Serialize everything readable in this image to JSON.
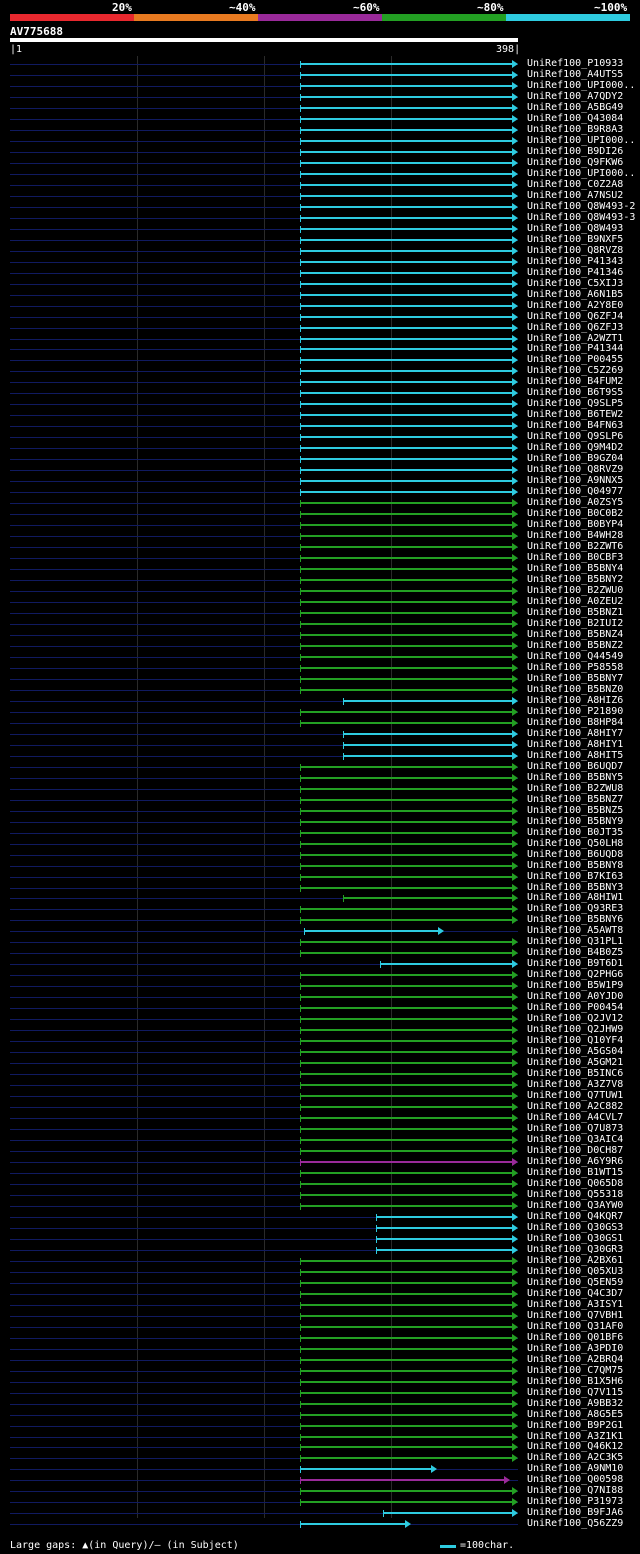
{
  "legend": {
    "labels": [
      "20%",
      "~40%",
      "~60%",
      "~80%",
      "~100%"
    ],
    "colors": [
      "#e8282e",
      "#e87a20",
      "#9a2a9a",
      "#23a023",
      "#2ecbe0"
    ]
  },
  "query": {
    "id": "AV775688",
    "start": "1",
    "end": "398"
  },
  "rows": [
    {
      "label": "UniRef100_P10933",
      "color": "cyan",
      "s": 0.57,
      "e": 1.0
    },
    {
      "label": "UniRef100_A4UTS5",
      "color": "cyan",
      "s": 0.57,
      "e": 1.0
    },
    {
      "label": "UniRef100_UPI000..",
      "color": "cyan",
      "s": 0.57,
      "e": 1.0
    },
    {
      "label": "UniRef100_A7QDY2",
      "color": "cyan",
      "s": 0.57,
      "e": 1.0
    },
    {
      "label": "UniRef100_A5BG49",
      "color": "cyan",
      "s": 0.57,
      "e": 1.0
    },
    {
      "label": "UniRef100_Q43084",
      "color": "cyan",
      "s": 0.57,
      "e": 1.0
    },
    {
      "label": "UniRef100_B9R8A3",
      "color": "cyan",
      "s": 0.57,
      "e": 1.0
    },
    {
      "label": "UniRef100_UPI000..",
      "color": "cyan",
      "s": 0.57,
      "e": 1.0
    },
    {
      "label": "UniRef100_B9DI26",
      "color": "cyan",
      "s": 0.57,
      "e": 1.0
    },
    {
      "label": "UniRef100_Q9FKW6",
      "color": "cyan",
      "s": 0.57,
      "e": 1.0
    },
    {
      "label": "UniRef100_UPI000..",
      "color": "cyan",
      "s": 0.57,
      "e": 1.0
    },
    {
      "label": "UniRef100_C0Z2A8",
      "color": "cyan",
      "s": 0.57,
      "e": 1.0
    },
    {
      "label": "UniRef100_A7NSU2",
      "color": "cyan",
      "s": 0.57,
      "e": 1.0
    },
    {
      "label": "UniRef100_Q8W493-2",
      "color": "cyan",
      "s": 0.57,
      "e": 1.0
    },
    {
      "label": "UniRef100_Q8W493-3",
      "color": "cyan",
      "s": 0.57,
      "e": 1.0
    },
    {
      "label": "UniRef100_Q8W493",
      "color": "cyan",
      "s": 0.57,
      "e": 1.0
    },
    {
      "label": "UniRef100_B9NXF5",
      "color": "cyan",
      "s": 0.57,
      "e": 1.0
    },
    {
      "label": "UniRef100_Q8RVZ8",
      "color": "cyan",
      "s": 0.57,
      "e": 1.0
    },
    {
      "label": "UniRef100_P41343",
      "color": "cyan",
      "s": 0.57,
      "e": 1.0
    },
    {
      "label": "UniRef100_P41346",
      "color": "cyan",
      "s": 0.57,
      "e": 1.0
    },
    {
      "label": "UniRef100_C5XIJ3",
      "color": "cyan",
      "s": 0.57,
      "e": 1.0
    },
    {
      "label": "UniRef100_A6N1B5",
      "color": "cyan",
      "s": 0.57,
      "e": 1.0
    },
    {
      "label": "UniRef100_A2Y8E0",
      "color": "cyan",
      "s": 0.57,
      "e": 1.0
    },
    {
      "label": "UniRef100_Q6ZFJ4",
      "color": "cyan",
      "s": 0.57,
      "e": 1.0
    },
    {
      "label": "UniRef100_Q6ZFJ3",
      "color": "cyan",
      "s": 0.57,
      "e": 1.0
    },
    {
      "label": "UniRef100_A2WZT1",
      "color": "cyan",
      "s": 0.57,
      "e": 1.0
    },
    {
      "label": "UniRef100_P41344",
      "color": "cyan",
      "s": 0.57,
      "e": 1.0
    },
    {
      "label": "UniRef100_P00455",
      "color": "cyan",
      "s": 0.57,
      "e": 1.0
    },
    {
      "label": "UniRef100_C5Z269",
      "color": "cyan",
      "s": 0.57,
      "e": 1.0
    },
    {
      "label": "UniRef100_B4FUM2",
      "color": "cyan",
      "s": 0.57,
      "e": 1.0
    },
    {
      "label": "UniRef100_B6T9S5",
      "color": "cyan",
      "s": 0.57,
      "e": 1.0
    },
    {
      "label": "UniRef100_Q9SLP5",
      "color": "cyan",
      "s": 0.57,
      "e": 1.0
    },
    {
      "label": "UniRef100_B6TEW2",
      "color": "cyan",
      "s": 0.57,
      "e": 1.0
    },
    {
      "label": "UniRef100_B4FN63",
      "color": "cyan",
      "s": 0.57,
      "e": 1.0
    },
    {
      "label": "UniRef100_Q9SLP6",
      "color": "cyan",
      "s": 0.57,
      "e": 1.0
    },
    {
      "label": "UniRef100_Q9M4D2",
      "color": "cyan",
      "s": 0.57,
      "e": 1.0
    },
    {
      "label": "UniRef100_B9GZ04",
      "color": "cyan",
      "s": 0.57,
      "e": 1.0
    },
    {
      "label": "UniRef100_Q8RVZ9",
      "color": "cyan",
      "s": 0.57,
      "e": 1.0
    },
    {
      "label": "UniRef100_A9NNX5",
      "color": "cyan",
      "s": 0.57,
      "e": 1.0
    },
    {
      "label": "UniRef100_Q04977",
      "color": "cyan",
      "s": 0.57,
      "e": 1.0
    },
    {
      "label": "UniRef100_A0ZSY5",
      "color": "green",
      "s": 0.57,
      "e": 1.0
    },
    {
      "label": "UniRef100_B0C0B2",
      "color": "green",
      "s": 0.57,
      "e": 1.0
    },
    {
      "label": "UniRef100_B0BYP4",
      "color": "green",
      "s": 0.57,
      "e": 1.0
    },
    {
      "label": "UniRef100_B4WH28",
      "color": "green",
      "s": 0.57,
      "e": 1.0
    },
    {
      "label": "UniRef100_B2ZWT6",
      "color": "green",
      "s": 0.57,
      "e": 1.0
    },
    {
      "label": "UniRef100_B0CBF3",
      "color": "green",
      "s": 0.57,
      "e": 1.0
    },
    {
      "label": "UniRef100_B5BNY4",
      "color": "green",
      "s": 0.57,
      "e": 1.0
    },
    {
      "label": "UniRef100_B5BNY2",
      "color": "green",
      "s": 0.57,
      "e": 1.0
    },
    {
      "label": "UniRef100_B2ZWU0",
      "color": "green",
      "s": 0.57,
      "e": 1.0
    },
    {
      "label": "UniRef100_A0ZEU2",
      "color": "green",
      "s": 0.57,
      "e": 1.0
    },
    {
      "label": "UniRef100_B5BNZ1",
      "color": "green",
      "s": 0.57,
      "e": 1.0
    },
    {
      "label": "UniRef100_B2IUI2",
      "color": "green",
      "s": 0.57,
      "e": 1.0
    },
    {
      "label": "UniRef100_B5BNZ4",
      "color": "green",
      "s": 0.57,
      "e": 1.0
    },
    {
      "label": "UniRef100_B5BNZ2",
      "color": "green",
      "s": 0.57,
      "e": 1.0
    },
    {
      "label": "UniRef100_Q44549",
      "color": "green",
      "s": 0.57,
      "e": 1.0
    },
    {
      "label": "UniRef100_P58558",
      "color": "green",
      "s": 0.57,
      "e": 1.0
    },
    {
      "label": "UniRef100_B5BNY7",
      "color": "green",
      "s": 0.57,
      "e": 1.0
    },
    {
      "label": "UniRef100_B5BNZ0",
      "color": "green",
      "s": 0.57,
      "e": 1.0
    },
    {
      "label": "UniRef100_A8HIZ6",
      "color": "cyan",
      "s": 0.655,
      "e": 1.0
    },
    {
      "label": "UniRef100_P21890",
      "color": "green",
      "s": 0.57,
      "e": 1.0
    },
    {
      "label": "UniRef100_B8HP84",
      "color": "green",
      "s": 0.57,
      "e": 1.0
    },
    {
      "label": "UniRef100_A8HIY7",
      "color": "cyan",
      "s": 0.655,
      "e": 1.0
    },
    {
      "label": "UniRef100_A8HIY1",
      "color": "cyan",
      "s": 0.655,
      "e": 1.0
    },
    {
      "label": "UniRef100_A8HIT5",
      "color": "cyan",
      "s": 0.655,
      "e": 1.0
    },
    {
      "label": "UniRef100_B6UQD7",
      "color": "green",
      "s": 0.57,
      "e": 1.0
    },
    {
      "label": "UniRef100_B5BNY5",
      "color": "green",
      "s": 0.57,
      "e": 1.0
    },
    {
      "label": "UniRef100_B2ZWU8",
      "color": "green",
      "s": 0.57,
      "e": 1.0
    },
    {
      "label": "UniRef100_B5BNZ7",
      "color": "green",
      "s": 0.57,
      "e": 1.0
    },
    {
      "label": "UniRef100_B5BNZ5",
      "color": "green",
      "s": 0.57,
      "e": 1.0
    },
    {
      "label": "UniRef100_B5BNY9",
      "color": "green",
      "s": 0.57,
      "e": 1.0
    },
    {
      "label": "UniRef100_B0JT35",
      "color": "green",
      "s": 0.57,
      "e": 1.0
    },
    {
      "label": "UniRef100_Q50LH8",
      "color": "green",
      "s": 0.57,
      "e": 1.0
    },
    {
      "label": "UniRef100_B6UQD8",
      "color": "green",
      "s": 0.57,
      "e": 1.0
    },
    {
      "label": "UniRef100_B5BNY8",
      "color": "green",
      "s": 0.57,
      "e": 1.0
    },
    {
      "label": "UniRef100_B7KI63",
      "color": "green",
      "s": 0.57,
      "e": 1.0
    },
    {
      "label": "UniRef100_B5BNY3",
      "color": "green",
      "s": 0.57,
      "e": 1.0
    },
    {
      "label": "UniRef100_A8HIW1",
      "color": "green",
      "s": 0.655,
      "e": 1.0
    },
    {
      "label": "UniRef100_Q93RE3",
      "color": "green",
      "s": 0.57,
      "e": 1.0
    },
    {
      "label": "UniRef100_B5BNY6",
      "color": "green",
      "s": 0.57,
      "e": 1.0
    },
    {
      "label": "UniRef100_A5AWT8",
      "color": "cyan",
      "s": 0.578,
      "e": 0.855
    },
    {
      "label": "UniRef100_Q31PL1",
      "color": "green",
      "s": 0.57,
      "e": 1.0
    },
    {
      "label": "UniRef100_B4B0Z5",
      "color": "green",
      "s": 0.57,
      "e": 1.0
    },
    {
      "label": "UniRef100_B9T6D1",
      "color": "cyan",
      "s": 0.728,
      "e": 1.0
    },
    {
      "label": "UniRef100_Q2PHG6",
      "color": "green",
      "s": 0.57,
      "e": 1.0
    },
    {
      "label": "UniRef100_B5W1P9",
      "color": "green",
      "s": 0.57,
      "e": 1.0
    },
    {
      "label": "UniRef100_A0YJD0",
      "color": "green",
      "s": 0.57,
      "e": 1.0
    },
    {
      "label": "UniRef100_P00454",
      "color": "green",
      "s": 0.57,
      "e": 1.0
    },
    {
      "label": "UniRef100_Q2JV12",
      "color": "green",
      "s": 0.57,
      "e": 1.0
    },
    {
      "label": "UniRef100_Q2JHW9",
      "color": "green",
      "s": 0.57,
      "e": 1.0
    },
    {
      "label": "UniRef100_Q10YF4",
      "color": "green",
      "s": 0.57,
      "e": 1.0
    },
    {
      "label": "UniRef100_A5GS04",
      "color": "green",
      "s": 0.57,
      "e": 1.0
    },
    {
      "label": "UniRef100_A5GM21",
      "color": "green",
      "s": 0.57,
      "e": 1.0
    },
    {
      "label": "UniRef100_B5INC6",
      "color": "green",
      "s": 0.57,
      "e": 1.0
    },
    {
      "label": "UniRef100_A3Z7V8",
      "color": "green",
      "s": 0.57,
      "e": 1.0
    },
    {
      "label": "UniRef100_Q7TUW1",
      "color": "green",
      "s": 0.57,
      "e": 1.0
    },
    {
      "label": "UniRef100_A2C882",
      "color": "green",
      "s": 0.57,
      "e": 1.0
    },
    {
      "label": "UniRef100_A4CVL7",
      "color": "green",
      "s": 0.57,
      "e": 1.0
    },
    {
      "label": "UniRef100_Q7U873",
      "color": "green",
      "s": 0.57,
      "e": 1.0
    },
    {
      "label": "UniRef100_Q3AIC4",
      "color": "green",
      "s": 0.57,
      "e": 1.0
    },
    {
      "label": "UniRef100_D0CH87",
      "color": "green",
      "s": 0.57,
      "e": 1.0
    },
    {
      "label": "UniRef100_A6Y9R6",
      "color": "purple",
      "s": 0.57,
      "e": 1.0
    },
    {
      "label": "UniRef100_B1WT15",
      "color": "green",
      "s": 0.57,
      "e": 1.0
    },
    {
      "label": "UniRef100_Q065D8",
      "color": "green",
      "s": 0.57,
      "e": 1.0
    },
    {
      "label": "UniRef100_Q55318",
      "color": "green",
      "s": 0.57,
      "e": 1.0
    },
    {
      "label": "UniRef100_Q3AYW0",
      "color": "green",
      "s": 0.57,
      "e": 1.0
    },
    {
      "label": "UniRef100_Q4KQR7",
      "color": "cyan",
      "s": 0.72,
      "e": 1.0
    },
    {
      "label": "UniRef100_Q30GS3",
      "color": "cyan",
      "s": 0.72,
      "e": 1.0
    },
    {
      "label": "UniRef100_Q30GS1",
      "color": "cyan",
      "s": 0.72,
      "e": 1.0
    },
    {
      "label": "UniRef100_Q30GR3",
      "color": "cyan",
      "s": 0.72,
      "e": 1.0
    },
    {
      "label": "UniRef100_A2BX61",
      "color": "green",
      "s": 0.57,
      "e": 1.0
    },
    {
      "label": "UniRef100_Q05XU3",
      "color": "green",
      "s": 0.57,
      "e": 1.0
    },
    {
      "label": "UniRef100_Q5EN59",
      "color": "green",
      "s": 0.57,
      "e": 1.0
    },
    {
      "label": "UniRef100_Q4C3D7",
      "color": "green",
      "s": 0.57,
      "e": 1.0
    },
    {
      "label": "UniRef100_A3ISY1",
      "color": "green",
      "s": 0.57,
      "e": 1.0
    },
    {
      "label": "UniRef100_Q7VBH1",
      "color": "green",
      "s": 0.57,
      "e": 1.0
    },
    {
      "label": "UniRef100_Q31AF0",
      "color": "green",
      "s": 0.57,
      "e": 1.0
    },
    {
      "label": "UniRef100_Q01BF6",
      "color": "green",
      "s": 0.57,
      "e": 1.0
    },
    {
      "label": "UniRef100_A3PDI0",
      "color": "green",
      "s": 0.57,
      "e": 1.0
    },
    {
      "label": "UniRef100_A2BRQ4",
      "color": "green",
      "s": 0.57,
      "e": 1.0
    },
    {
      "label": "UniRef100_C7QM75",
      "color": "green",
      "s": 0.57,
      "e": 1.0
    },
    {
      "label": "UniRef100_B1X5H6",
      "color": "green",
      "s": 0.57,
      "e": 1.0
    },
    {
      "label": "UniRef100_Q7V115",
      "color": "green",
      "s": 0.57,
      "e": 1.0
    },
    {
      "label": "UniRef100_A9BB32",
      "color": "green",
      "s": 0.57,
      "e": 1.0
    },
    {
      "label": "UniRef100_A8G5E5",
      "color": "green",
      "s": 0.57,
      "e": 1.0
    },
    {
      "label": "UniRef100_B9P2G1",
      "color": "green",
      "s": 0.57,
      "e": 1.0
    },
    {
      "label": "UniRef100_A3Z1K1",
      "color": "green",
      "s": 0.57,
      "e": 1.0
    },
    {
      "label": "UniRef100_Q46K12",
      "color": "green",
      "s": 0.57,
      "e": 1.0
    },
    {
      "label": "UniRef100_A2C3K5",
      "color": "green",
      "s": 0.57,
      "e": 1.0
    },
    {
      "label": "UniRef100_A9NM10",
      "color": "cyan",
      "s": 0.57,
      "e": 0.84
    },
    {
      "label": "UniRef100_Q00598",
      "color": "purple",
      "s": 0.57,
      "e": 0.985
    },
    {
      "label": "UniRef100_Q7NI88",
      "color": "green",
      "s": 0.57,
      "e": 1.0
    },
    {
      "label": "UniRef100_P31973",
      "color": "green",
      "s": 0.57,
      "e": 1.0
    },
    {
      "label": "UniRef100_B9FJA6",
      "color": "cyan",
      "s": 0.735,
      "e": 1.0
    },
    {
      "label": "UniRef100_Q56ZZ9",
      "color": "cyan",
      "s": 0.57,
      "e": 0.79
    }
  ],
  "footer": {
    "gaps_text": "Large gaps: ▲(in Query)/‒ (in Subject)",
    "scale_text": "=100char."
  }
}
